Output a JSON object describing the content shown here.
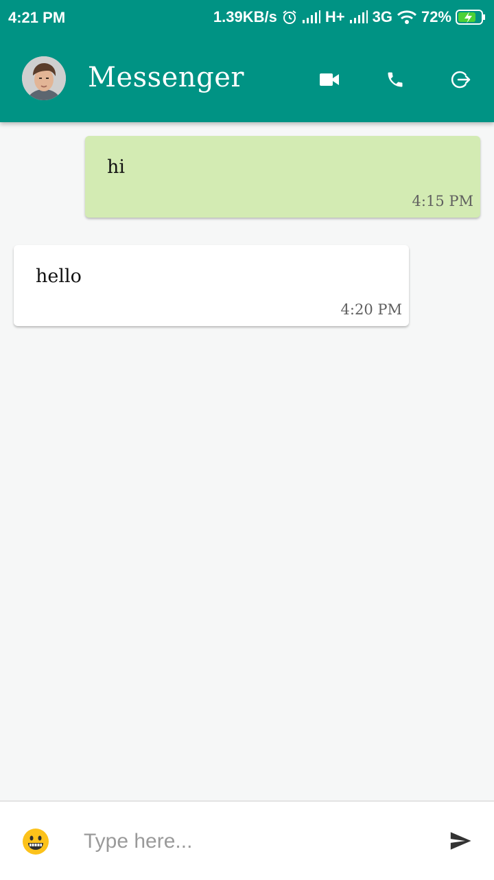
{
  "status_bar": {
    "time": "4:21 PM",
    "speed": "1.39KB/s",
    "network1": "H+",
    "network2": "3G",
    "battery": "72%"
  },
  "header": {
    "title": "Messenger",
    "icons": [
      "video-call-icon",
      "phone-call-icon",
      "logout-icon"
    ]
  },
  "messages": [
    {
      "direction": "sent",
      "text": "hi",
      "time": "4:15 PM"
    },
    {
      "direction": "received",
      "text": "hello",
      "time": "4:20 PM"
    }
  ],
  "composer": {
    "placeholder": "Type here...",
    "value": ""
  },
  "colors": {
    "primary": "#009384",
    "sent_bubble": "#d3ebb3",
    "received_bubble": "#ffffff",
    "background": "#f6f7f7"
  }
}
